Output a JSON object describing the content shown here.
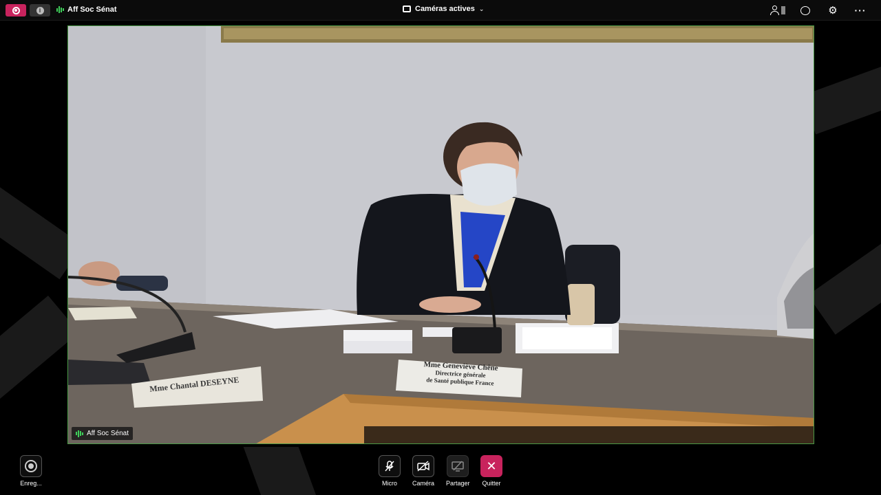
{
  "topbar": {
    "room_name": "Aff Soc Sénat",
    "view_mode": "Caméras actives",
    "icons": [
      "record-icon",
      "info-icon",
      "participants-icon",
      "chat-icon",
      "settings-icon",
      "more-icon"
    ]
  },
  "video": {
    "participant_label": "Aff Soc Sénat",
    "nameplate_left": "Mme Chantal DESEYNE",
    "nameplate_center": {
      "line1": "Mme Geneviève Chêne",
      "line2": "Directrice générale",
      "line3": "de Santé publique France"
    }
  },
  "controls": {
    "record_label": "Enreg...",
    "mic_label": "Micro",
    "camera_label": "Caméra",
    "share_label": "Partager",
    "quit_label": "Quitter"
  },
  "colors": {
    "accent": "#c8235d",
    "audio_level": "#3fcf5a",
    "tile_border": "#4a9a46"
  }
}
